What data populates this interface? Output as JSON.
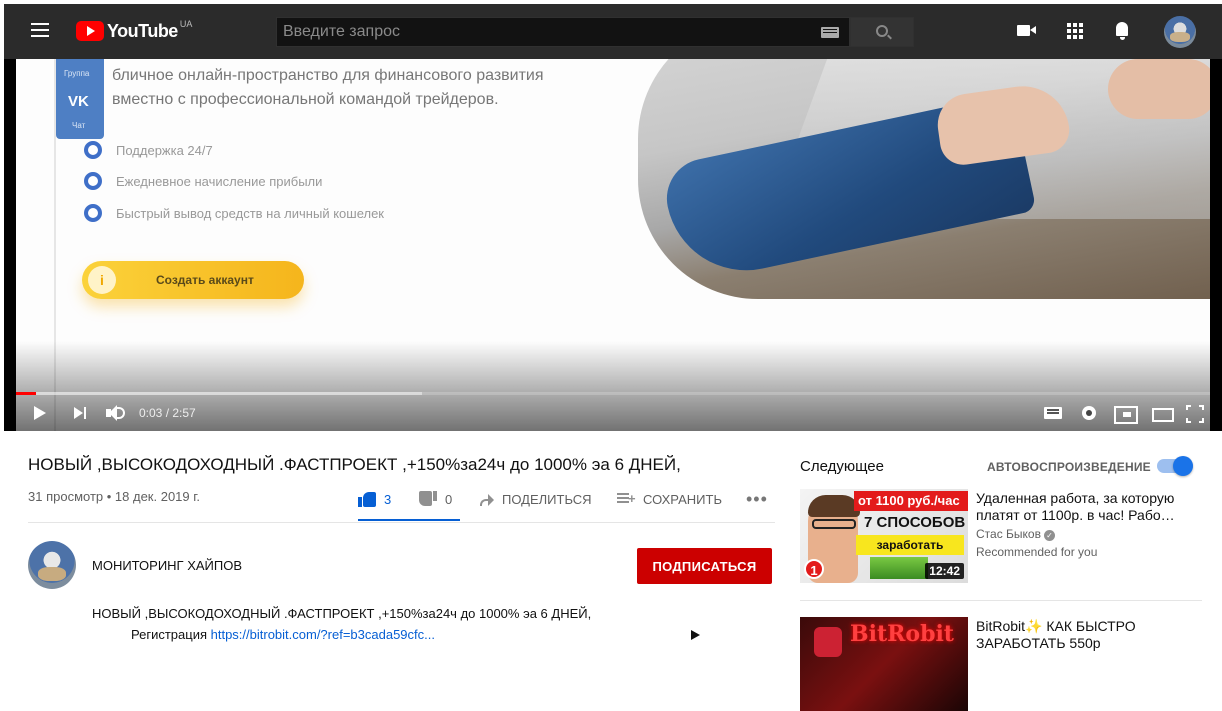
{
  "header": {
    "logo_text": "YouTube",
    "logo_country": "UA",
    "search_placeholder": "Введите запрос"
  },
  "player": {
    "slide": {
      "vk_group": "Группа",
      "vk_logo": "VK",
      "vk_chat": "Чат",
      "line1": "бличное онлайн-пространство для финансового развития",
      "line2": "вместно с профессиональной командой трейдеров.",
      "features": [
        "Поддержка 24/7",
        "Ежедневное начисление прибыли",
        "Быстрый вывод средств на личный кошелек"
      ],
      "cta_icon": "i",
      "cta": "Создать аккаунт"
    },
    "time_current": "0:03",
    "time_total": "2:57",
    "time_display": "0:03 / 2:57",
    "progress_played_fraction": 0.017,
    "progress_loaded_fraction": 0.34
  },
  "video": {
    "title": "НОВЫЙ ,ВЫСОКОДОХОДНЫЙ .ФАСТПРОЕКТ ,+150%за24ч до 1000% эа 6 ДНЕЙ,",
    "views_date": "31 просмотр • 18 дек. 2019 г.",
    "likes": "3",
    "dislikes": "0",
    "share_label": "ПОДЕЛИТЬСЯ",
    "save_label": "СОХРАНИТЬ",
    "more_label": "•••"
  },
  "channel": {
    "name": "МОНИТОРИНГ ХАЙПОВ",
    "subscribe_label": "ПОДПИСАТЬСЯ"
  },
  "description": {
    "line1": "НОВЫЙ ,ВЫСОКОДОХОДНЫЙ .ФАСТПРОЕКТ ,+150%за24ч до 1000% эа 6 ДНЕЙ,",
    "line2_prefix": "Регистрация ",
    "line2_link": "https://bitrobit.com/?ref=b3cada59cfc..."
  },
  "sidebar": {
    "up_next": "Следующее",
    "autoplay_label": "АВТОВОСПРОИЗВЕДЕНИЕ",
    "autoplay_on": true,
    "recommendations": [
      {
        "title": "Удаленная работа, за которую платят от 1100р. в час! Рабо…",
        "channel": "Стас Быков",
        "extra": "Recommended for you",
        "duration": "12:42",
        "thumb_badge": "от 1100 руб./час",
        "thumb_line1": "7 СПОСОБОВ",
        "thumb_line2": "заработать",
        "thumb_number": "1"
      },
      {
        "title": "BitRobit✨ КАК БЫСТРО ЗАРАБОТАТЬ 550р",
        "thumb_brand": "BitRobit"
      }
    ]
  },
  "colors": {
    "accent_blue": "#065fd4",
    "subscribe_red": "#cc0000",
    "progress_red": "#ff0000",
    "topbar": "#2b2b2b"
  }
}
